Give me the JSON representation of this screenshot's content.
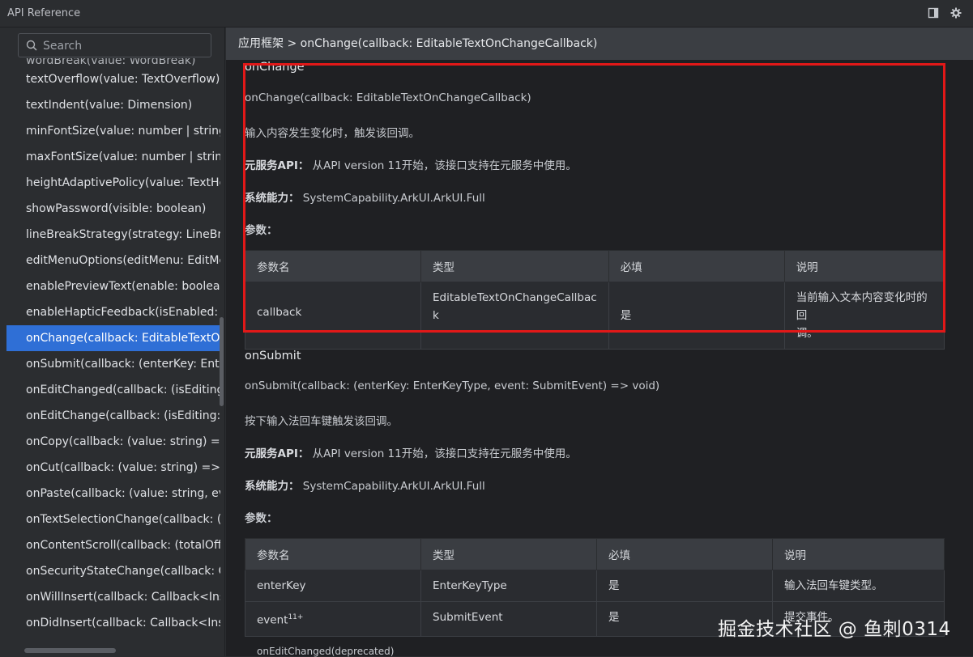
{
  "window": {
    "title": "API Reference",
    "icons": [
      "panel-layout-icon",
      "gear-icon"
    ]
  },
  "search": {
    "placeholder": "Search"
  },
  "sidebar": {
    "items": [
      {
        "label": "wordBreak(value: WordBreak)"
      },
      {
        "label": "textOverflow(value: TextOverflow)"
      },
      {
        "label": "textIndent(value: Dimension)"
      },
      {
        "label": "minFontSize(value: number | string | Re"
      },
      {
        "label": "maxFontSize(value: number | string | Re"
      },
      {
        "label": "heightAdaptivePolicy(value: TextHeight"
      },
      {
        "label": "showPassword(visible: boolean)"
      },
      {
        "label": "lineBreakStrategy(strategy: LineBreakSt"
      },
      {
        "label": "editMenuOptions(editMenu: EditMenuO"
      },
      {
        "label": "enablePreviewText(enable: boolean)"
      },
      {
        "label": "enableHapticFeedback(isEnabled: boole"
      },
      {
        "label": "onChange(callback: EditableTextOnCha"
      },
      {
        "label": "onSubmit(callback: (enterKey: EnterKey"
      },
      {
        "label": "onEditChanged(callback: (isEditing: boo"
      },
      {
        "label": "onEditChange(callback: (isEditing: boole"
      },
      {
        "label": "onCopy(callback: (value: string) => voic"
      },
      {
        "label": "onCut(callback: (value: string) => void)"
      },
      {
        "label": "onPaste(callback: (value: string, event: F"
      },
      {
        "label": "onTextSelectionChange(callback: (selec"
      },
      {
        "label": "onContentScroll(callback: (totalOffsetX:"
      },
      {
        "label": "onSecurityStateChange(callback: Callba"
      },
      {
        "label": "onWillInsert(callback: Callback<InsertVa"
      },
      {
        "label": "onDidInsert(callback: Callback<InsertVa"
      }
    ]
  },
  "breadcrumb": "应用框架 > onChange(callback: EditableTextOnChangeCallback)",
  "onchange": {
    "heading": "onChange",
    "signature": "onChange(callback: EditableTextOnChangeCallback)",
    "desc": "输入内容发生变化时，触发该回调。",
    "meta_label": "元服务API：",
    "meta_value": "从API version 11开始，该接口支持在元服务中使用。",
    "syscap_label": "系统能力：",
    "syscap_value": "SystemCapability.ArkUI.ArkUI.Full",
    "params_label": "参数：",
    "headers": [
      "参数名",
      "类型",
      "必填",
      "说明"
    ],
    "rows": [
      {
        "name": "callback",
        "type": "EditableTextOnChangeCallbac\nk",
        "required": "是",
        "desc": "当前输入文本内容变化时的回\n调。"
      }
    ]
  },
  "onsubmit": {
    "heading": "onSubmit",
    "signature": "onSubmit(callback: (enterKey: EnterKeyType, event: SubmitEvent) => void)",
    "desc": "按下输入法回车键触发该回调。",
    "meta_label": "元服务API：",
    "meta_value": "从API version 11开始，该接口支持在元服务中使用。",
    "syscap_label": "系统能力：",
    "syscap_value": "SystemCapability.ArkUI.ArkUI.Full",
    "params_label": "参数：",
    "headers": [
      "参数名",
      "类型",
      "必填",
      "说明"
    ],
    "rows": [
      {
        "name": "enterKey",
        "sup": "",
        "type": "EnterKeyType",
        "required": "是",
        "desc": "输入法回车键类型。"
      },
      {
        "name": "event",
        "sup": "11+",
        "type": "SubmitEvent",
        "required": "是",
        "desc": "提交事件。"
      }
    ]
  },
  "next_heading_partial": "onEditChanged(deprecated)",
  "watermark": "掘金技术社区 @ 鱼刺0314"
}
